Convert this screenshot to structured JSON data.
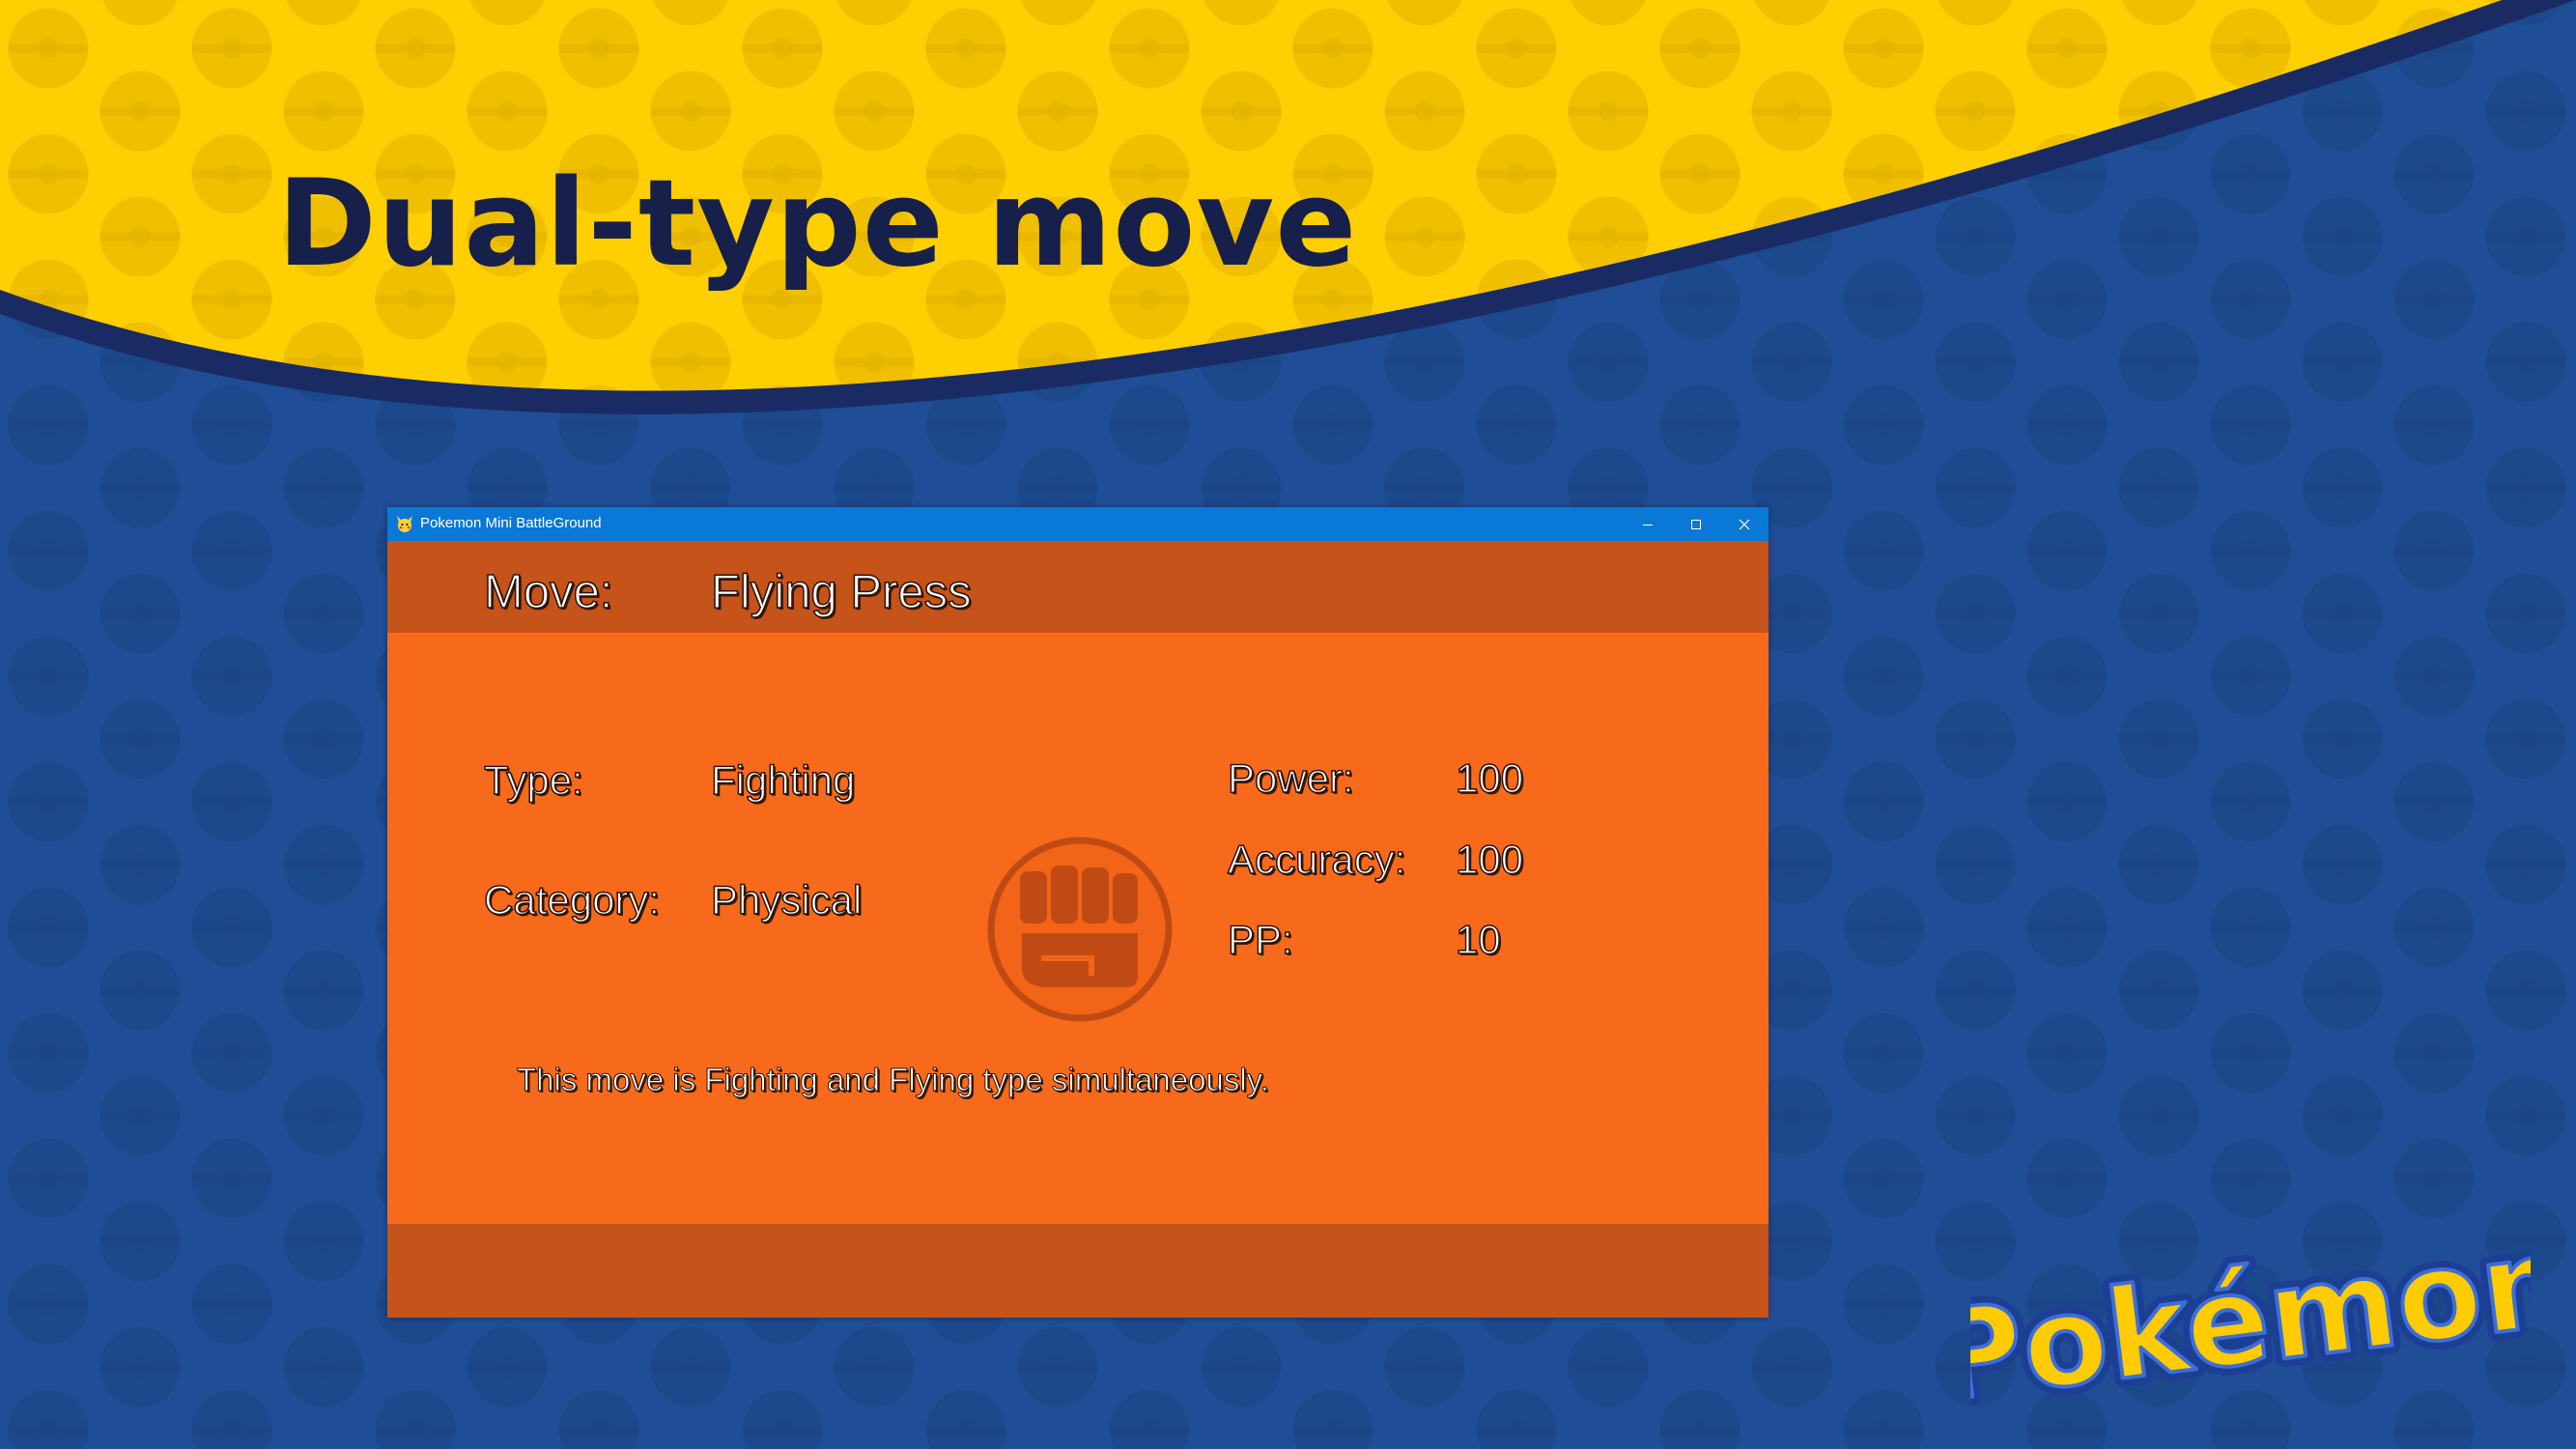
{
  "slide": {
    "title": "Dual-type move"
  },
  "window": {
    "title": "Pokemon Mini BattleGround",
    "icon": "pikachu-icon"
  },
  "move": {
    "move_label": "Move:",
    "move_name": "Flying Press",
    "type_label": "Type:",
    "type_value": "Fighting",
    "category_label": "Category:",
    "category_value": "Physical",
    "power_label": "Power:",
    "power_value": "100",
    "accuracy_label": "Accuracy:",
    "accuracy_value": "100",
    "pp_label": "PP:",
    "pp_value": "10",
    "type_icon": "fist-icon",
    "description": "This move is Fighting and Flying type simultaneously."
  },
  "logo": {
    "text": "Pokémon"
  },
  "colors": {
    "slide_yellow": "#ffcf01",
    "slide_blue": "#1f4e97",
    "title_navy": "#17204b",
    "window_orange": "#f76a1c",
    "band_orange": "#c65319",
    "titlebar_blue": "#0a78d7"
  }
}
